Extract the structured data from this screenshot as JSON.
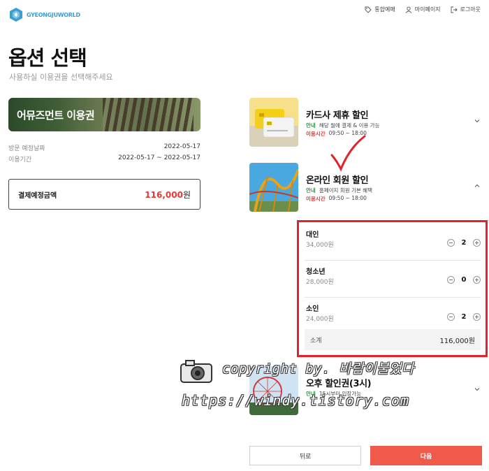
{
  "brand": {
    "logo_text": "GYEONGJUWORLD",
    "accent": "#3a9fd1"
  },
  "top_nav": [
    {
      "label": "통합예매",
      "icon": "tag-icon"
    },
    {
      "label": "마이페이지",
      "icon": "user-icon"
    },
    {
      "label": "로그아웃",
      "icon": "logout-icon"
    }
  ],
  "page": {
    "title": "옵션 선택",
    "subtitle": "사용하실 이용권을 선택해주세요"
  },
  "ticket": {
    "banner_label": "어뮤즈먼트 이용권",
    "visit_date_label": "방문 예정날짜",
    "visit_date_value": "2022-05-17",
    "period_label": "이용기간",
    "period_value": "2022-05-17 ~ 2022-05-17",
    "pay_label": "결제예정금액",
    "pay_amount": "116,000",
    "pay_unit": "원"
  },
  "options": [
    {
      "name": "카드사 제휴 할인",
      "info_tag": "안내",
      "info_text": "해당 월에 결제 & 이용 가능",
      "time_tag": "이용시간",
      "time_text": "09:50 ~ 18:00",
      "expanded": false
    },
    {
      "name": "온라인 회원 할인",
      "info_tag": "안내",
      "info_text": "홈페이지 회원 기본 혜택",
      "time_tag": "이용시간",
      "time_text": "09:50 ~ 18:00",
      "expanded": true
    },
    {
      "name": "오후 할인권(3시)",
      "info_tag": "안내",
      "info_text": "15시부터 입장가능",
      "expanded": false
    }
  ],
  "tiers": [
    {
      "name": "대인",
      "price": "34,000원",
      "count": "2"
    },
    {
      "name": "청소년",
      "price": "28,000원",
      "count": "0"
    },
    {
      "name": "소인",
      "price": "24,000원",
      "count": "2"
    }
  ],
  "subtotal": {
    "label": "소계",
    "value": "116,000원"
  },
  "buttons": {
    "back": "뒤로",
    "next": "다음"
  },
  "watermark": {
    "line1": "copyright by. 바람이불었다",
    "line2": "https://windy.tistory.com"
  },
  "colors": {
    "highlight_border": "#e0232c",
    "price_red": "#e53935",
    "next_button": "#f05a4b",
    "info_green": "#2e9b43"
  }
}
